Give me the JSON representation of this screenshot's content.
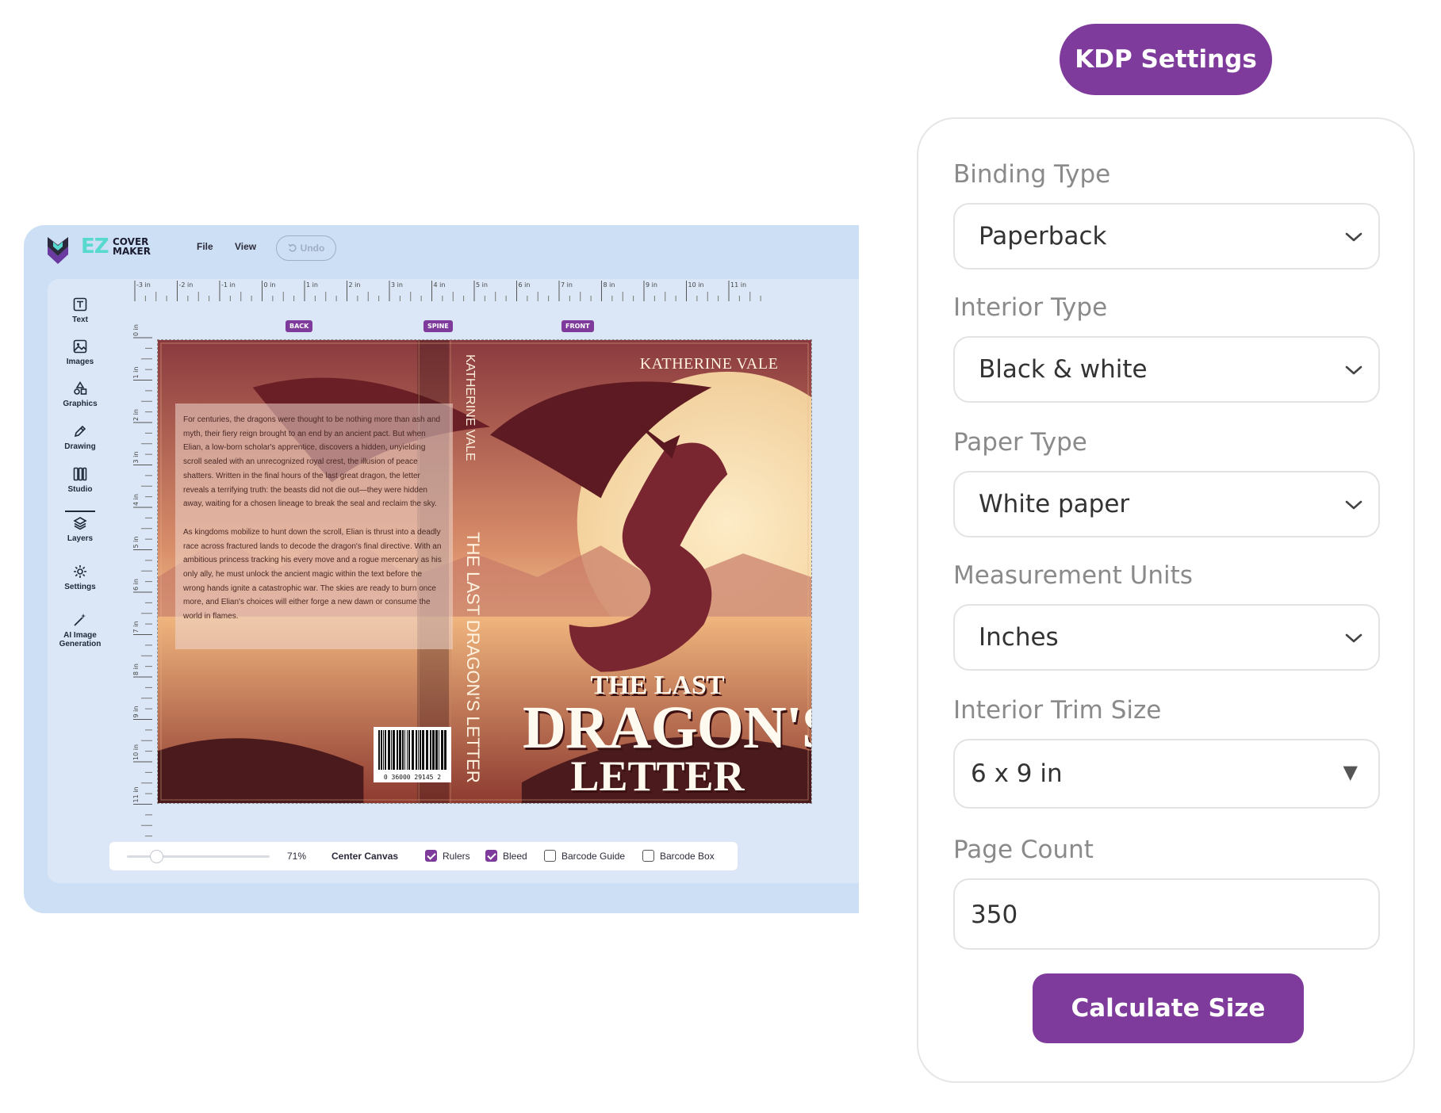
{
  "editor": {
    "logo": {
      "ez": "EZ",
      "line1": "COVER",
      "line2": "MAKER"
    },
    "menu": {
      "file": "File",
      "view": "View",
      "undo": "Undo"
    },
    "tools": [
      {
        "label": "Text",
        "icon": "text-icon"
      },
      {
        "label": "Images",
        "icon": "image-icon"
      },
      {
        "label": "Graphics",
        "icon": "shapes-icon"
      },
      {
        "label": "Drawing",
        "icon": "pen-icon"
      },
      {
        "label": "Studio",
        "icon": "studio-icon"
      },
      {
        "label": "Layers",
        "icon": "layers-icon"
      },
      {
        "label": "Settings",
        "icon": "gear-icon"
      },
      {
        "label": "AI Image",
        "label2": "Generation",
        "icon": "magic-wand-icon"
      }
    ],
    "ruler_top": [
      "-3 in",
      "-2 in",
      "-1 in",
      "0 in",
      "1 in",
      "2 in",
      "3 in",
      "4 in",
      "5 in",
      "6 in",
      "7 in",
      "8 in",
      "9 in",
      "10 in",
      "11 in"
    ],
    "ruler_left": [
      "0 in",
      "1 in",
      "2 in",
      "3 in",
      "4 in",
      "5 in",
      "6 in",
      "7 in",
      "8 in",
      "9 in",
      "10 in",
      "11 in"
    ],
    "markers": {
      "back": "BACK",
      "spine": "SPINE",
      "front": "FRONT"
    },
    "cover": {
      "author": "KATHERINE VALE",
      "spine_author": "KATHERINE VALE",
      "spine_title": "THE LAST DRAGON'S LETTER",
      "title_line1": "THE LAST",
      "title_line2": "DRAGON'S",
      "title_line3": "LETTER",
      "blurb_p1": "For centuries, the dragons were thought to be nothing more than ash and myth, their fiery reign brought to an end by an ancient pact. But when Elian, a low-born scholar's apprentice, discovers a hidden, unyielding scroll sealed with an unrecognized royal crest, the illusion of peace shatters. Written in the final hours of the last great dragon, the letter reveals a terrifying truth: the beasts did not die out—they were hidden away, waiting for a chosen lineage to break the seal and reclaim the sky.",
      "blurb_p2": "As kingdoms mobilize to hunt down the scroll, Elian is thrust into a deadly race across fractured lands to decode the dragon's final directive. With an ambitious princess tracking his every move and a rogue mercenary as his only ally, he must unlock the ancient magic within the text before the wrong hands ignite a catastrophic war. The skies are ready to burn once more, and Elian's choices will either forge a new dawn or consume the world in flames.",
      "barcode_number": "0   36000 29145   2"
    },
    "bottom_bar": {
      "zoom_value": 0.71,
      "zoom_label": "71%",
      "center_canvas": "Center Canvas",
      "rulers": {
        "label": "Rulers",
        "checked": true
      },
      "bleed": {
        "label": "Bleed",
        "checked": true
      },
      "barcode_guide": {
        "label": "Barcode Guide",
        "checked": false
      },
      "barcode_box": {
        "label": "Barcode Box",
        "checked": false
      }
    }
  },
  "kdp": {
    "title": "KDP Settings",
    "binding_type": {
      "label": "Binding Type",
      "value": "Paperback"
    },
    "interior_type": {
      "label": "Interior Type",
      "value": "Black & white"
    },
    "paper_type": {
      "label": "Paper Type",
      "value": "White paper"
    },
    "measurement_units": {
      "label": "Measurement Units",
      "value": "Inches"
    },
    "trim_size": {
      "label": "Interior Trim Size",
      "value": "6 x 9 in"
    },
    "page_count": {
      "label": "Page Count",
      "value": "350"
    },
    "calculate_button": "Calculate Size"
  },
  "colors": {
    "accent": "#7e3b9b",
    "editor_bg": "#cddff4",
    "workspace_bg": "#dbe7f6"
  }
}
